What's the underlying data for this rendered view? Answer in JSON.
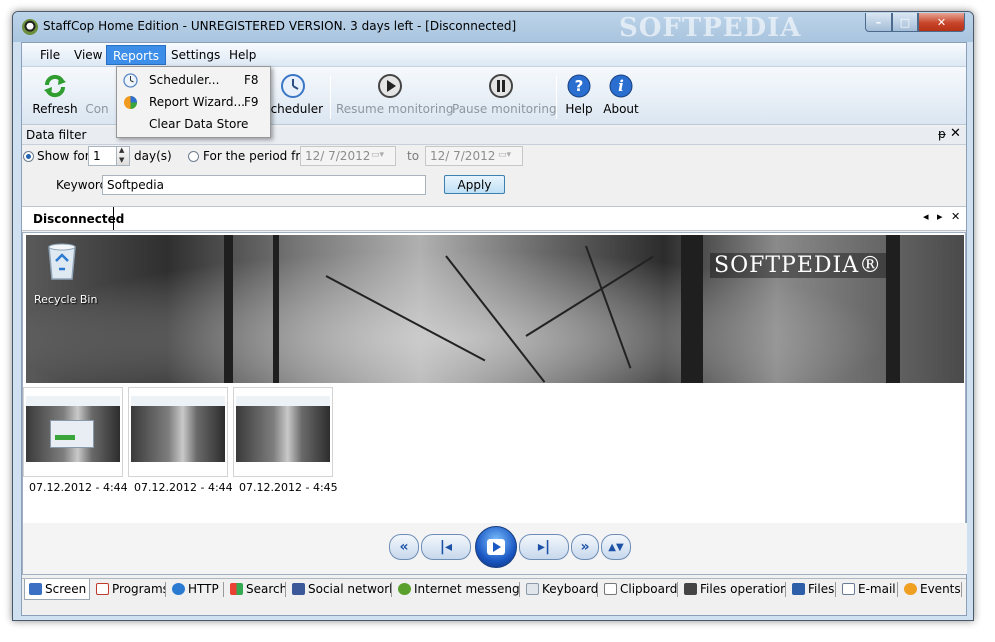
{
  "window": {
    "title": "StaffCop Home Edition - UNREGISTERED VERSION. 3 days left - [Disconnected]",
    "watermark": "SOFTPEDIA",
    "controls": {
      "minimize": "–",
      "maximize": "□",
      "close": "✕"
    }
  },
  "menu": {
    "items": [
      "File",
      "View",
      "Reports",
      "Settings",
      "Help"
    ],
    "active": "Reports"
  },
  "reports_dropdown": {
    "items": [
      {
        "label": "Scheduler...",
        "shortcut": "F8",
        "icon": "clock-icon"
      },
      {
        "label": "Report Wizard...",
        "shortcut": "F9",
        "icon": "report-wizard-icon"
      },
      {
        "label": "Clear Data Store",
        "shortcut": "",
        "icon": ""
      }
    ]
  },
  "toolbar": {
    "refresh": "Refresh",
    "connect": "Con",
    "scheduler": "Scheduler",
    "resume": "Resume monitoring",
    "pause": "Pause monitoring",
    "help": "Help",
    "about": "About"
  },
  "data_filter": {
    "header": "Data filter",
    "pin": "ᵽ",
    "close": "✕",
    "show_for_label": "Show for",
    "show_for_value": "1",
    "days_label": "day(s)",
    "period_label": "For the period from",
    "date_from": "12/  7/2012",
    "to_label": "to",
    "date_to": "12/  7/2012",
    "keyword_label": "Keyword",
    "keyword_value": "Softpedia",
    "apply": "Apply"
  },
  "doc_tab": {
    "label": "Disconnected",
    "nav_prev": "◂",
    "nav_next": "▸",
    "close": "✕"
  },
  "screenshot": {
    "recycle_bin": "Recycle Bin",
    "logo": "SOFTPEDIA®"
  },
  "thumbnails": [
    {
      "label": "07.12.2012 - 4:44"
    },
    {
      "label": "07.12.2012 - 4:44"
    },
    {
      "label": "07.12.2012 - 4:45"
    }
  ],
  "player": {
    "rewind": "«",
    "prev": "|◂",
    "play": "▶",
    "next": "▸|",
    "forward": "»",
    "updown": "▲▼"
  },
  "bottom_tabs": [
    {
      "label": "Screen",
      "color": "#3a6fc4"
    },
    {
      "label": "Programs",
      "color": "#c0392b"
    },
    {
      "label": "HTTP",
      "color": "#2b7ad1"
    },
    {
      "label": "Search",
      "color": "#e2a21c"
    },
    {
      "label": "Social network",
      "color": "#3b5998"
    },
    {
      "label": "Internet messenger",
      "color": "#5aa02c"
    },
    {
      "label": "Keyboard",
      "color": "#8a9aaa"
    },
    {
      "label": "Clipboard",
      "color": "#777777"
    },
    {
      "label": "Files operation",
      "color": "#444444"
    },
    {
      "label": "Files",
      "color": "#2d5fa8"
    },
    {
      "label": "E-mail",
      "color": "#6b7d96"
    },
    {
      "label": "Events",
      "color": "#f0a020"
    }
  ]
}
